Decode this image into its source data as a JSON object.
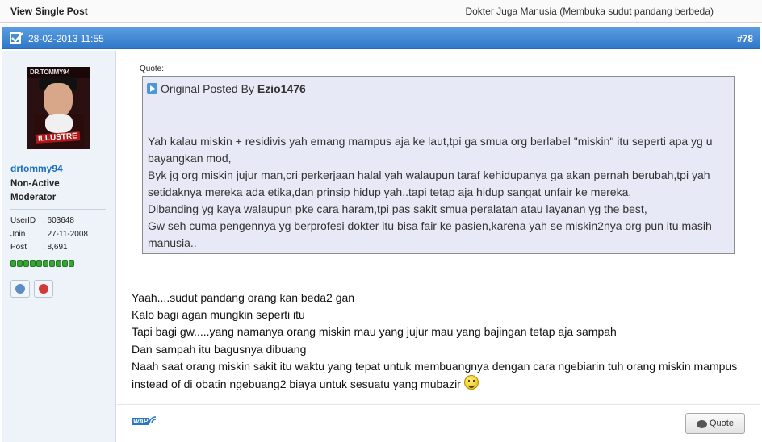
{
  "topbar": {
    "title": "View Single Post",
    "thread_title": "Dokter Juga Manusia (Membuka sudut pandang berbeda)"
  },
  "post": {
    "date": "28-02-2013 11:55",
    "number": "#78"
  },
  "user": {
    "avatar_text_top": "DR.TOMMY94",
    "avatar_text_bottom": "ILLUSTRE",
    "name": "drtommy94",
    "title": "Non-Active Moderator",
    "info": [
      {
        "key": "UserID",
        "value": ": 603648"
      },
      {
        "key": "Join",
        "value": ": 27-11-2008"
      },
      {
        "key": "Post",
        "value": ": 8,691"
      }
    ],
    "reputation_blocks": 10
  },
  "quote": {
    "label": "Quote:",
    "prefix": "Original Posted By ",
    "author": "Ezio1476",
    "lines": [
      "Yah kalau miskin + residivis yah emang mampus aja ke laut,tpi ga smua org berlabel \"miskin\" itu seperti apa yg u",
      "bayangkan mod,",
      "Byk jg org miskin jujur man,cri perkerjaan halal yah walaupun taraf kehidupanya ga akan pernah berubah,tpi yah",
      "setidaknya mereka ada etika,dan prinsip hidup yah..tapi tetap aja hidup sangat unfair ke mereka,",
      "Dibanding yg kaya walaupun pke cara haram,tpi pas sakit smua peralatan atau layanan yg the best,",
      "Gw seh cuma pengennya yg berprofesi dokter itu bisa fair ke pasien,karena yah se miskin2nya org pun itu masih",
      "manusia.."
    ]
  },
  "body": {
    "lines": [
      "Yaah....sudut pandang orang kan beda2 gan",
      "Kalo bagi agan mungkin seperti itu",
      "Tapi bagi gw.....yang namanya orang miskin mau yang jujur mau yang bajingan tetap aja sampah",
      "Dan sampah itu bagusnya dibuang",
      "Naah saat orang miskin sakit itu waktu yang tepat untuk membuangnya dengan cara ngebiarin tuh orang miskin mampus",
      "instead of di obatin ngebuang2 biaya untuk sesuatu yang mubazir"
    ]
  },
  "footer": {
    "wap_label": "WAP",
    "quote_button": "Quote"
  },
  "colors": {
    "header_blue": "#2f78c9",
    "username_blue": "#1d6fbd",
    "quote_bg": "#e8e9f6",
    "sidebar_bg": "#edf3f9"
  }
}
